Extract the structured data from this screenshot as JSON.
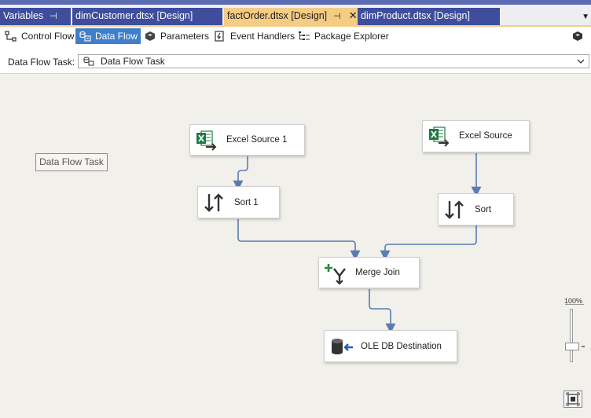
{
  "tabs": [
    {
      "label": "Variables",
      "pin": "⊣"
    },
    {
      "label": "dimCustomer.dtsx [Design]"
    },
    {
      "label": "factOrder.dtsx [Design]",
      "pin": "⊣",
      "close": "✕"
    },
    {
      "label": "dimProduct.dtsx [Design]"
    }
  ],
  "toolbar": {
    "control_flow": "Control Flow",
    "data_flow": "Data Flow",
    "parameters": "Parameters",
    "event_handlers": "Event Handlers",
    "package_explorer": "Package Explorer"
  },
  "task": {
    "label": "Data Flow Task:",
    "value": "Data Flow Task"
  },
  "canvas": {
    "annotation": "Data Flow Task",
    "components": {
      "excel_source_1": "Excel Source 1",
      "excel_source": "Excel Source",
      "sort_1": "Sort 1",
      "sort": "Sort",
      "merge_join": "Merge Join",
      "ole_db_destination": "OLE DB Destination"
    }
  },
  "zoom": {
    "level": "100%"
  },
  "colors": {
    "accent": "#5d6bb0",
    "active_tab": "#f5cc84",
    "inactive_tab": "#3e4d9c",
    "active_toolbar": "#3e7ecb",
    "connector": "#5b7bb4",
    "excel_green": "#1f7a44"
  }
}
